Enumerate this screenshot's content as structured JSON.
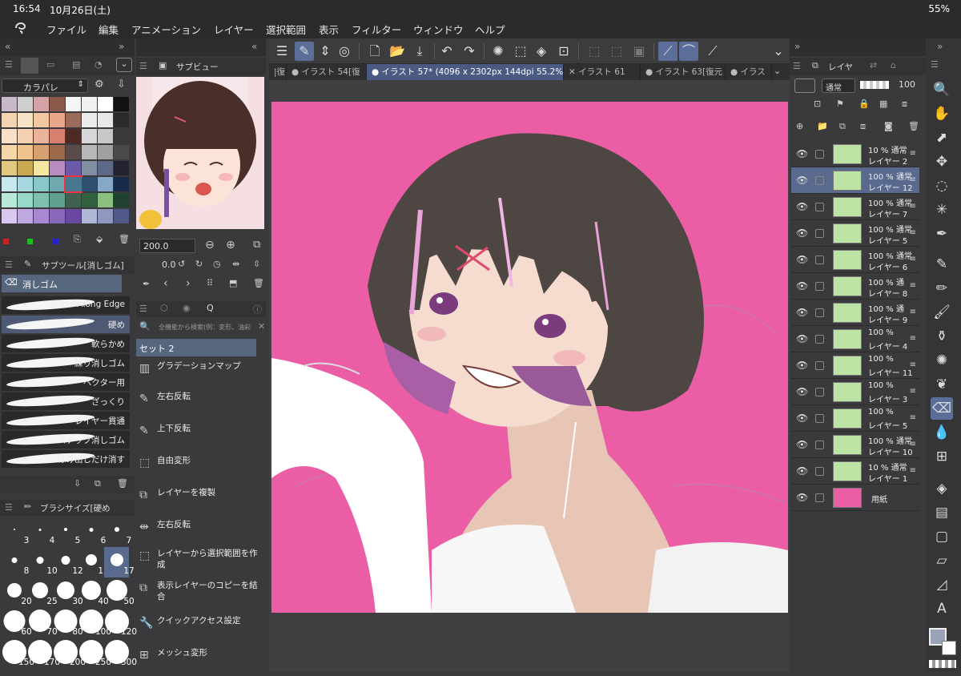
{
  "status": {
    "time": "16:54",
    "date": "10月26日(土)",
    "battery": "55%"
  },
  "menu": [
    "ファイル",
    "編集",
    "アニメーション",
    "レイヤー",
    "選択範囲",
    "表示",
    "フィルター",
    "ウィンドウ",
    "ヘルプ"
  ],
  "tabs": [
    {
      "label": "|復"
    },
    {
      "label": "● イラスト 54[復"
    },
    {
      "label": "● イラスト 57* (4096 x 2302px 144dpi 55.2%)",
      "active": true
    },
    {
      "label": "✕ イラスト 61"
    },
    {
      "label": "● イラスト 63[復元"
    },
    {
      "label": "● イラス"
    }
  ],
  "color_panel": {
    "title": "カラパレ"
  },
  "sub_view": {
    "title": "サブビュー",
    "zoom": "200.0",
    "rotation": "0.0"
  },
  "subtool": {
    "title": "サブツール[消しゴム]",
    "group": "消しゴム",
    "items": [
      {
        "label": "Erase Along Edge"
      },
      {
        "label": "硬め",
        "selected": true
      },
      {
        "label": "軟らかめ"
      },
      {
        "label": "練り消しゴム"
      },
      {
        "label": "ベクター用"
      },
      {
        "label": "ざっくり"
      },
      {
        "label": "レイヤー貫通"
      },
      {
        "label": "スナップ消しゴム"
      },
      {
        "label": "はみ出しだけ消す"
      }
    ]
  },
  "brush_size": {
    "title": "ブラシサイズ[硬め",
    "sizes": [
      "3",
      "4",
      "5",
      "6",
      "7",
      "8",
      "10",
      "12",
      "15",
      "17",
      "20",
      "25",
      "30",
      "40",
      "50",
      "60",
      "70",
      "80",
      "100",
      "120",
      "150",
      "170",
      "200",
      "250",
      "300"
    ],
    "selected": "17"
  },
  "quick_access": {
    "search_placeholder": "全機能から検索(例：変形、油彩",
    "set": "セット 2",
    "items": [
      {
        "label": "グラデーションマップ"
      },
      {
        "label": "左右反転"
      },
      {
        "label": "上下反転"
      },
      {
        "label": "自由変形"
      },
      {
        "label": "レイヤーを複製"
      },
      {
        "label": "左右反転"
      },
      {
        "label": "レイヤーから選択範囲を作成"
      },
      {
        "label": "表示レイヤーのコピーを結合"
      },
      {
        "label": "クイックアクセス設定"
      },
      {
        "label": "メッシュ変形"
      }
    ]
  },
  "layer_panel": {
    "title": "レイヤ",
    "blend_mode": "通常",
    "opacity": "100",
    "layers": [
      {
        "opacity": "10 % 通常",
        "name": "レイヤー 2"
      },
      {
        "opacity": "100 % 通常",
        "name": "レイヤー 12",
        "selected": true
      },
      {
        "opacity": "100 % 通常",
        "name": "レイヤー 7"
      },
      {
        "opacity": "100 % 通常",
        "name": "レイヤー 5"
      },
      {
        "opacity": "100 % 通常",
        "name": "レイヤー 6"
      },
      {
        "opacity": "100 % 通",
        "name": "レイヤー 8"
      },
      {
        "opacity": "100 % 通",
        "name": "レイヤー 9"
      },
      {
        "opacity": "100 %",
        "name": "レイヤー 4"
      },
      {
        "opacity": "100 %",
        "name": "レイヤー 11"
      },
      {
        "opacity": "100 %",
        "name": "レイヤー 3"
      },
      {
        "opacity": "100 %",
        "name": "レイヤー 5"
      },
      {
        "opacity": "100 % 通常",
        "name": "レイヤー 10"
      },
      {
        "opacity": "10 % 通常",
        "name": "レイヤー 1"
      },
      {
        "opacity": "",
        "name": "用紙",
        "paper": true
      }
    ]
  },
  "colors": {
    "canvas_bg": "#eb5ea5",
    "accent": "#5b6e9a",
    "layer_thumb": "#bde3a5"
  }
}
